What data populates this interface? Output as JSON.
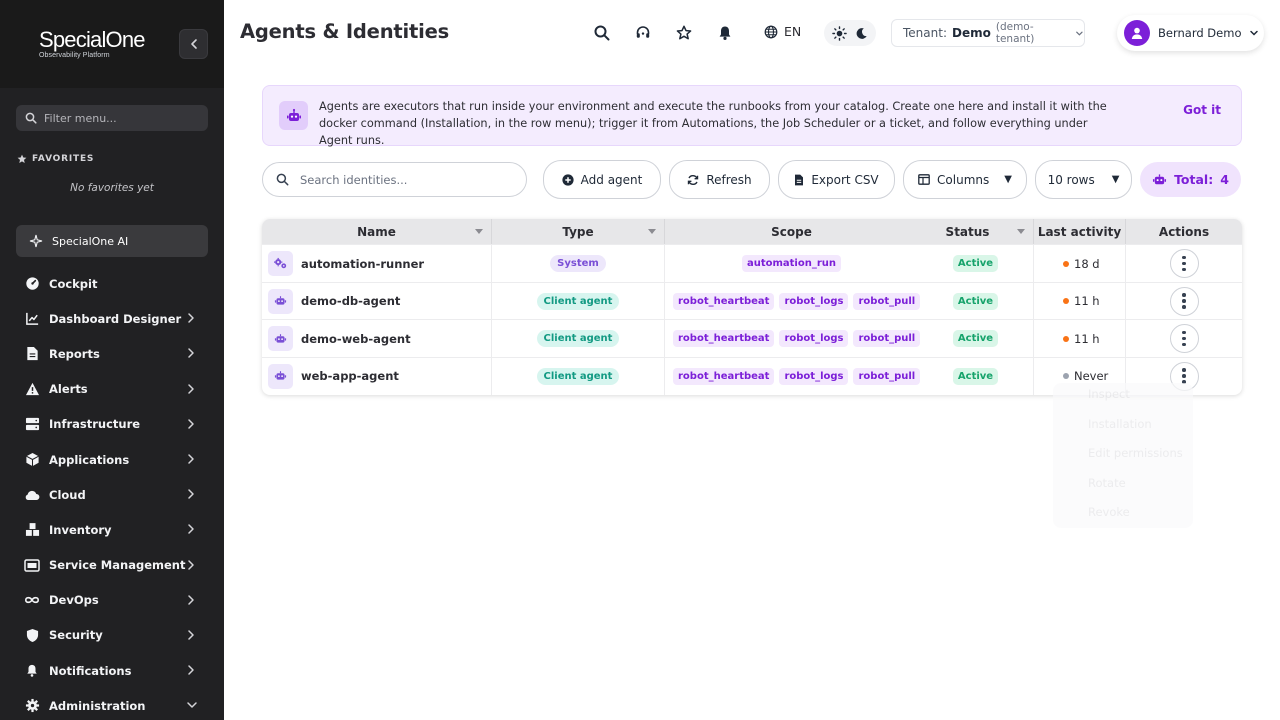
{
  "brand": {
    "name": "SpecialOne",
    "tagline": "Observability Platform"
  },
  "sidebar": {
    "filter_placeholder": "Filter menu...",
    "favorites_title": "FAVORITES",
    "no_favorites": "No favorites yet",
    "ai_label": "SpecialOne AI",
    "items": [
      {
        "label": "Cockpit",
        "icon": "gauge-icon",
        "expandable": false
      },
      {
        "label": "Dashboard Designer",
        "icon": "chart-line-icon",
        "expandable": true
      },
      {
        "label": "Reports",
        "icon": "document-icon",
        "expandable": true
      },
      {
        "label": "Alerts",
        "icon": "warning-icon",
        "expandable": true
      },
      {
        "label": "Infrastructure",
        "icon": "server-icon",
        "expandable": true
      },
      {
        "label": "Applications",
        "icon": "cube-icon",
        "expandable": true
      },
      {
        "label": "Cloud",
        "icon": "cloud-icon",
        "expandable": true
      },
      {
        "label": "Inventory",
        "icon": "boxes-icon",
        "expandable": true
      },
      {
        "label": "Service Management",
        "icon": "ticket-icon",
        "expandable": true
      },
      {
        "label": "DevOps",
        "icon": "infinity-icon",
        "expandable": true
      },
      {
        "label": "Security",
        "icon": "shield-icon",
        "expandable": true
      },
      {
        "label": "Notifications",
        "icon": "bell-icon",
        "expandable": true
      },
      {
        "label": "Administration",
        "icon": "gear-icon",
        "expandable": true,
        "expanded": true
      }
    ]
  },
  "header": {
    "title": "Agents & Identities",
    "language": "EN",
    "tenant_label": "Tenant:",
    "tenant_name": "Demo",
    "tenant_id": "(demo-tenant)",
    "user_name": "Bernard Demo"
  },
  "banner": {
    "text": "Agents are executors that run inside your environment and execute the runbooks from your catalog. Create one here and install it with the docker command (Installation, in the row menu); trigger it from Automations, the Job Scheduler or a ticket, and follow everything under Agent runs.",
    "dismiss": "Got it"
  },
  "toolbar": {
    "search_placeholder": "Search identities...",
    "add": "Add agent",
    "refresh": "Refresh",
    "export": "Export CSV",
    "columns": "Columns",
    "rows": "10 rows",
    "total_label": "Total:",
    "total_value": "4"
  },
  "table": {
    "columns": [
      "Name",
      "Type",
      "Scope",
      "Status",
      "Last activity",
      "Actions"
    ],
    "rows": [
      {
        "name": "automation-runner",
        "type": "System",
        "type_kind": "system",
        "scopes": [
          "automation_run"
        ],
        "status": "Active",
        "last": "18 d",
        "dot": "#f97316",
        "icon": "gears-icon"
      },
      {
        "name": "demo-db-agent",
        "type": "Client agent",
        "type_kind": "client",
        "scopes": [
          "robot_heartbeat",
          "robot_logs",
          "robot_pull"
        ],
        "status": "Active",
        "last": "11 h",
        "dot": "#f97316",
        "icon": "robot-icon"
      },
      {
        "name": "demo-web-agent",
        "type": "Client agent",
        "type_kind": "client",
        "scopes": [
          "robot_heartbeat",
          "robot_logs",
          "robot_pull"
        ],
        "status": "Active",
        "last": "11 h",
        "dot": "#f97316",
        "icon": "robot-icon"
      },
      {
        "name": "web-app-agent",
        "type": "Client agent",
        "type_kind": "client",
        "scopes": [
          "robot_heartbeat",
          "robot_logs",
          "robot_pull"
        ],
        "status": "Active",
        "last": "Never",
        "dot": "#9ca3af",
        "icon": "robot-icon"
      }
    ]
  },
  "ghost_menu": [
    "Inspect",
    "Installation",
    "Edit permissions",
    "Rotate",
    "Revoke"
  ],
  "colors": {
    "accent": "#7c1fd8",
    "sidebar": "#212123",
    "active_green": "#16a36b"
  }
}
